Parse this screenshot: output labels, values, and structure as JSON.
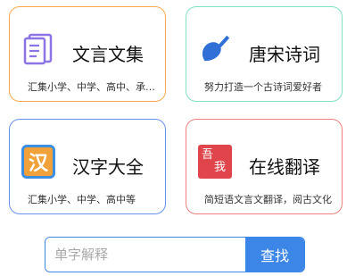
{
  "cards": [
    {
      "title": "文言文集",
      "subtitle": "汇集小学、中学、高中、承传经典",
      "icon": "document-list-icon",
      "border_color": "#f7a94b"
    },
    {
      "title": "唐宋诗词",
      "subtitle": "努力打造一个古诗词爱好者",
      "icon": "ink-brush-icon",
      "border_color": "#7fe0c4"
    },
    {
      "title": "汉字大全",
      "subtitle": "汇集小学、中学、高中等",
      "icon": "hanzi-icon",
      "icon_char": "汉",
      "border_color": "#6a8ff0"
    },
    {
      "title": "在线翻译",
      "subtitle": "简短语文言文翻译，阅古文化",
      "icon": "seal-stamp-icon",
      "icon_chars": [
        "吾",
        "我"
      ],
      "border_color": "#f07f7f"
    }
  ],
  "search": {
    "placeholder": "单字解释",
    "button_label": "查找",
    "accent_color": "#3c86e8"
  }
}
